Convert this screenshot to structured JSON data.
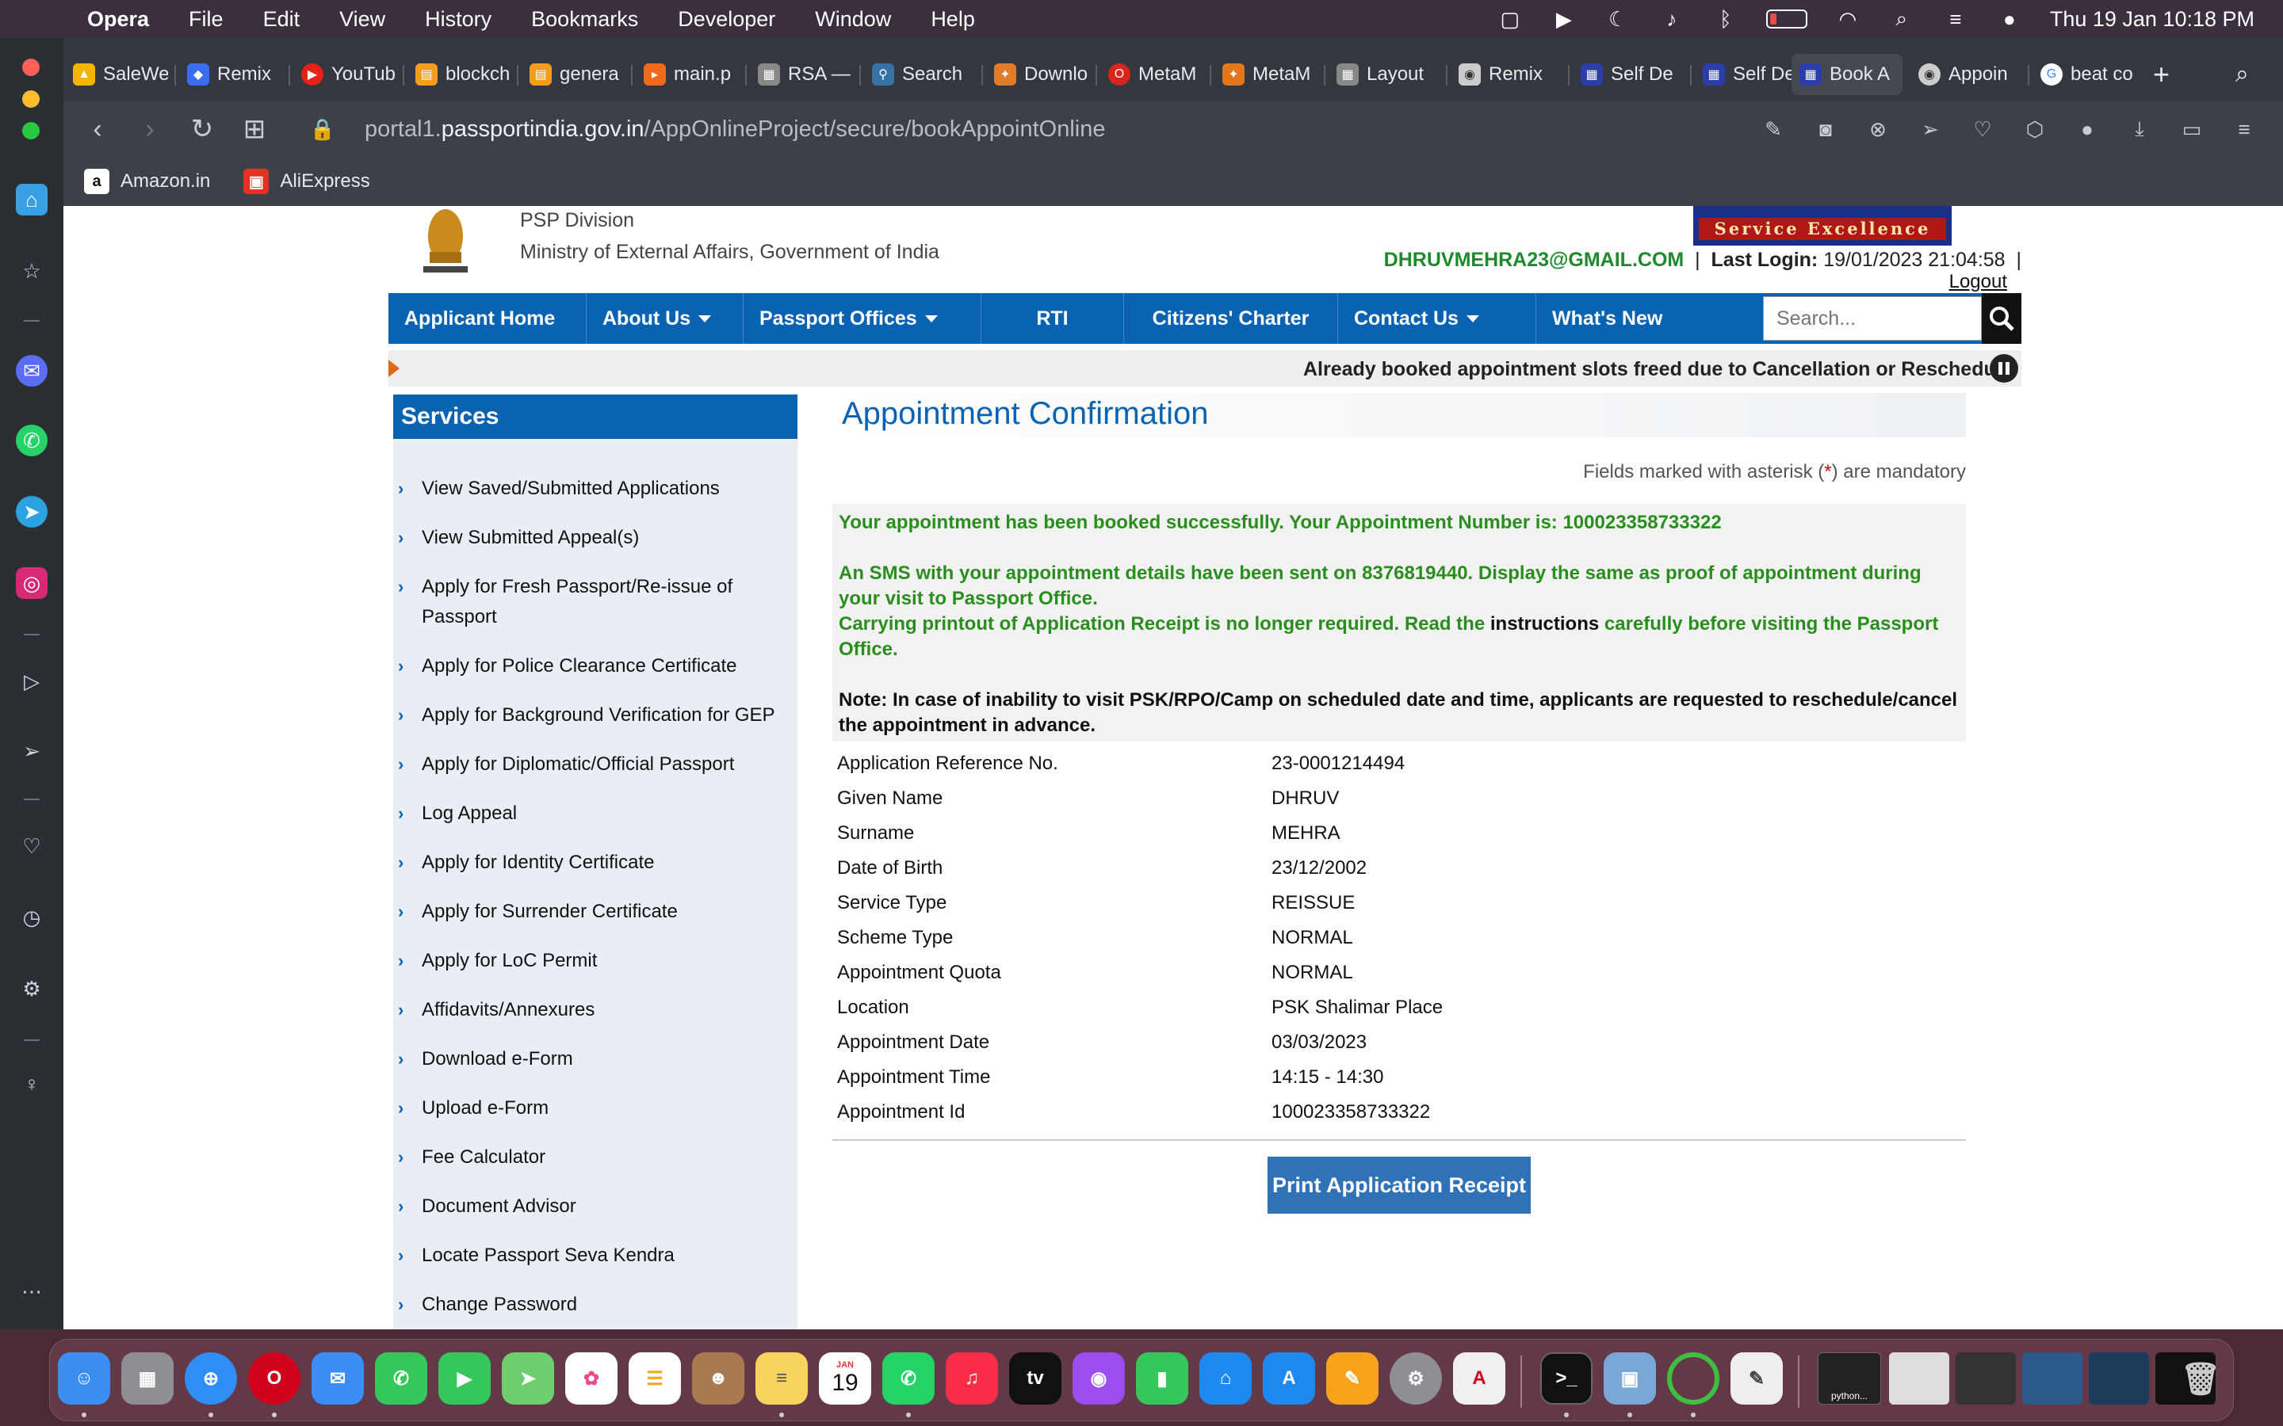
{
  "menubar": {
    "app": "Opera",
    "items": [
      "File",
      "Edit",
      "View",
      "History",
      "Bookmarks",
      "Developer",
      "Window",
      "Help"
    ],
    "clock": "Thu 19 Jan  10:18 PM"
  },
  "tabs": [
    {
      "label": "SaleWe",
      "color": "#f4b400"
    },
    {
      "label": "Remix",
      "color": "#3a6df0"
    },
    {
      "label": "YouTub",
      "color": "#e62117"
    },
    {
      "label": "blockch",
      "color": "#f29d1f"
    },
    {
      "label": "genera",
      "color": "#f29d1f"
    },
    {
      "label": "main.p",
      "color": "#f06a1c"
    },
    {
      "label": "RSA —",
      "color": "#888"
    },
    {
      "label": "Search",
      "color": "#3572a5"
    },
    {
      "label": "Downlo",
      "color": "#e07b2a"
    },
    {
      "label": "MetaM",
      "color": "#d9261c"
    },
    {
      "label": "MetaM",
      "color": "#e2761b"
    },
    {
      "label": "Layout",
      "color": "#888"
    },
    {
      "label": "Remix",
      "color": "#ccc"
    },
    {
      "label": "Self De",
      "color": "#2a3da8"
    },
    {
      "label": "Self De",
      "color": "#2a3da8"
    },
    {
      "label": "Book A",
      "color": "#2a3da8"
    },
    {
      "label": "Appoin",
      "color": "#ccc"
    },
    {
      "label": "beat co",
      "color": "#4285f4"
    }
  ],
  "address": {
    "prefix": "portal1.",
    "host": "passportindia.gov.in",
    "path": "/AppOnlineProject/secure/bookAppointOnline"
  },
  "bookmarks": [
    {
      "label": "Amazon.in",
      "glyph": "a"
    },
    {
      "label": "AliExpress",
      "glyph": "▣"
    }
  ],
  "site": {
    "division": "PSP Division",
    "ministry": "Ministry of External Affairs, Government of India",
    "badge": "Service Excellence",
    "email": "DHRUVMEHRA23@GMAIL.COM",
    "last_login_label": "Last Login:",
    "last_login_value": "19/01/2023 21:04:58",
    "logout": "Logout",
    "nav": [
      {
        "label": "Applicant Home",
        "dropdown": false
      },
      {
        "label": "About Us",
        "dropdown": true
      },
      {
        "label": "Passport Offices",
        "dropdown": true
      },
      {
        "label": "RTI",
        "dropdown": false
      },
      {
        "label": "Citizens' Charter",
        "dropdown": false
      },
      {
        "label": "Contact Us",
        "dropdown": true
      },
      {
        "label": "What's New",
        "dropdown": false
      }
    ],
    "search_placeholder": "Search...",
    "ticker": "Already booked appointment slots freed due to Cancellation or Reschedule"
  },
  "services": {
    "title": "Services",
    "items": [
      "View Saved/Submitted Applications",
      "View Submitted Appeal(s)",
      "Apply for Fresh Passport/Re-issue of Passport",
      "Apply for Police Clearance Certificate",
      "Apply for Background Verification for GEP",
      "Apply for Diplomatic/Official Passport",
      "Log Appeal",
      "Apply for Identity Certificate",
      "Apply for Surrender Certificate",
      "Apply for LoC Permit",
      "Affidavits/Annexures",
      "Download e-Form",
      "Upload e-Form",
      "Fee Calculator",
      "Document Advisor",
      "Locate Passport Seva Kendra",
      "Change Password"
    ]
  },
  "confirmation": {
    "title": "Appointment Confirmation",
    "mandatory_pre": "Fields marked with asterisk (",
    "mandatory_star": "*",
    "mandatory_post": ") are mandatory",
    "msg1": "Your appointment has been booked successfully. Your Appointment Number is: 100023358733322",
    "msg2": "An SMS with your appointment details have been sent on 8376819440. Display the same as proof of appointment during your visit to Passport Office.",
    "msg3_pre": "Carrying printout of Application Receipt is no longer required. Read the ",
    "msg3_link": "instructions",
    "msg3_post": " carefully before visiting the Passport Office.",
    "note": "Note: In case of inability to visit PSK/RPO/Camp on scheduled date and time, applicants are requested to reschedule/cancel the appointment in advance.",
    "details": [
      {
        "label": "Application Reference No.",
        "value": "23-0001214494"
      },
      {
        "label": "Given Name",
        "value": "DHRUV"
      },
      {
        "label": "Surname",
        "value": "MEHRA"
      },
      {
        "label": "Date of Birth",
        "value": "23/12/2002"
      },
      {
        "label": "Service Type",
        "value": "REISSUE"
      },
      {
        "label": "Scheme Type",
        "value": "NORMAL"
      },
      {
        "label": "Appointment Quota",
        "value": "NORMAL"
      },
      {
        "label": "Location",
        "value": "PSK Shalimar Place"
      },
      {
        "label": "Appointment Date",
        "value": "03/03/2023"
      },
      {
        "label": "Appointment Time",
        "value": "14:15 - 14:30"
      },
      {
        "label": "Appointment Id",
        "value": "100023358733322"
      }
    ],
    "print_button": "Print Application Receipt"
  },
  "dock": {
    "calendar_month": "JAN",
    "calendar_day": "19",
    "tv_label": "tv",
    "terminal_caption": "python..."
  }
}
